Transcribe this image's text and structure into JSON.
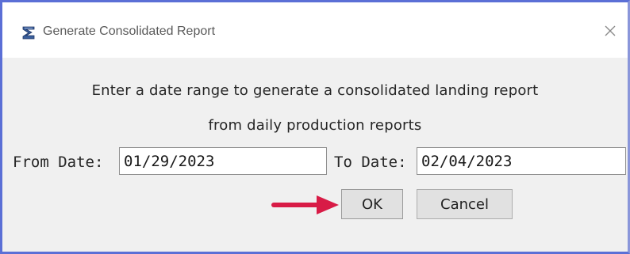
{
  "window": {
    "title": "Generate Consolidated Report",
    "app_icon": "report-app-icon",
    "close_icon": "close-icon"
  },
  "message": {
    "line1": "Enter a date range to generate a consolidated landing report",
    "line2": "from daily production reports"
  },
  "form": {
    "from_label": "From Date:",
    "from_value": "01/29/2023",
    "to_label": "To Date:",
    "to_value": "02/04/2023"
  },
  "buttons": {
    "ok_label": "OK",
    "cancel_label": "Cancel"
  },
  "annotation": {
    "arrow_icon": "red-arrow-icon",
    "arrow_color": "#d81b46"
  },
  "colors": {
    "window_border": "#5b6fd6",
    "dialog_bg": "#f0f0f0",
    "button_bg": "#e1e1e1"
  }
}
